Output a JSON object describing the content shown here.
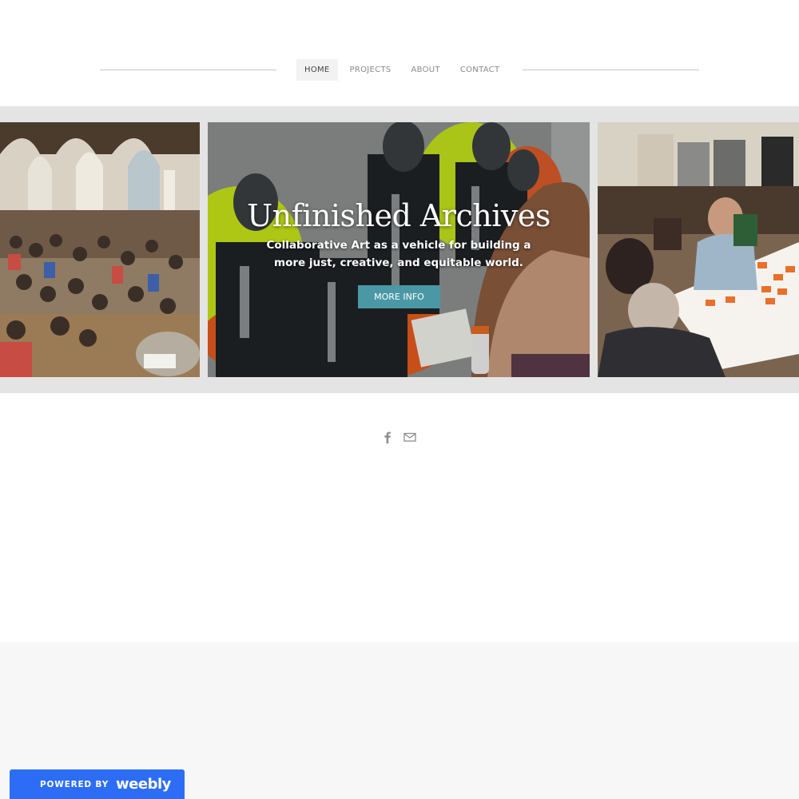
{
  "nav": {
    "items": [
      {
        "label": "HOME",
        "active": true
      },
      {
        "label": "PROJECTS",
        "active": false
      },
      {
        "label": "ABOUT",
        "active": false
      },
      {
        "label": "CONTACT",
        "active": false
      }
    ]
  },
  "hero": {
    "title": "Unfinished Archives",
    "subtitle": "Collaborative Art as a vehicle for building a more just, creative, and equitable world.",
    "button_label": "MORE INFO"
  },
  "banner_images": {
    "left": "church-hall-gathering-photo",
    "center": "mural-painting-photo",
    "right": "workshop-table-photo"
  },
  "social": {
    "icons": [
      "facebook-icon",
      "mail-icon"
    ]
  },
  "badge": {
    "prefix": "POWERED BY",
    "brand": "weebly"
  },
  "colors": {
    "accent": "#4a98a6",
    "badge": "#2d6df6",
    "banner_bg": "#e4e4e4",
    "footer_bg": "#f7f7f7"
  }
}
